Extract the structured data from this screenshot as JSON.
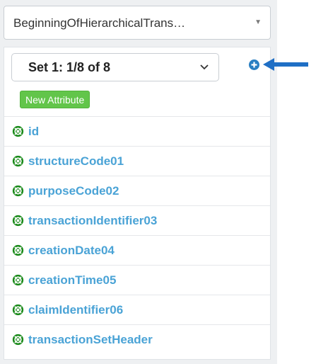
{
  "selector": {
    "value": "BeginningOfHierarchicalTrans…",
    "caret_icon": "caret-down-icon"
  },
  "set_select": {
    "value": "Set 1: 1/8 of 8",
    "icon": "chevron-down-icon"
  },
  "add_button": {
    "icon": "plus-circle-icon",
    "color": "#2a7fc2"
  },
  "new_attribute_button": {
    "label": "New Attribute",
    "color": "#62c54a"
  },
  "attributes": [
    {
      "label": "id",
      "icon": "lifebuoy-icon"
    },
    {
      "label": "structureCode01",
      "icon": "lifebuoy-icon"
    },
    {
      "label": "purposeCode02",
      "icon": "lifebuoy-icon"
    },
    {
      "label": "transactionIdentifier03",
      "icon": "lifebuoy-icon"
    },
    {
      "label": "creationDate04",
      "icon": "lifebuoy-icon"
    },
    {
      "label": "creationTime05",
      "icon": "lifebuoy-icon"
    },
    {
      "label": "claimIdentifier06",
      "icon": "lifebuoy-icon"
    },
    {
      "label": "transactionSetHeader",
      "icon": "lifebuoy-icon"
    }
  ],
  "colors": {
    "attribute_icon": "#1a8a1a",
    "attribute_text": "#4aa3d6",
    "callout_arrow": "#1f6fc5"
  },
  "callout": {
    "icon": "arrow-left-icon"
  }
}
